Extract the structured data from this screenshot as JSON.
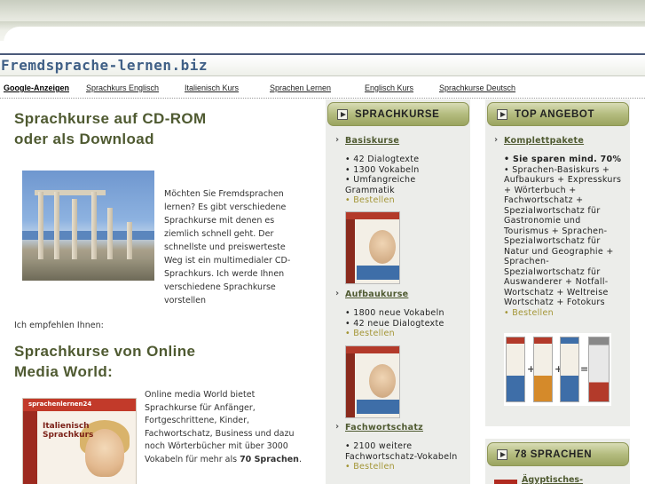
{
  "header": {
    "site_title": "Fremdsprache-lernen.biz"
  },
  "ads": {
    "label": "Google-Anzeigen",
    "links": [
      "Sprachkurs Englisch",
      "Italienisch Kurs",
      "Sprachen Lernen",
      "Englisch Kurs",
      "Sprachkurse Deutsch"
    ]
  },
  "main": {
    "heading1": "Sprachkurse auf CD-ROM oder als Download",
    "intro": "Möchten Sie Fremdsprachen lernen? Es gibt verschiedene Sprachkurse mit denen es ziemlich schnell geht. Der schnellste und preiswerteste Weg ist ein multimedialer CD-Sprachkurs. Ich werde Ihnen verschiedene Sprachkurse vorstellen",
    "recommend": "Ich empfehlen Ihnen:",
    "heading2": "Sprachkurse von Online Media World:",
    "para2_text": "Online media World bietet Sprachkurse für Anfänger, Fortgeschrittene, Kinder, Fachwortschatz, Business und dazu noch Wörterbücher mit über 3000 Vokabeln für mehr als ",
    "para2_bold": "70 Sprachen",
    "para2_end": ".",
    "box_brand": "sprachenlernen24",
    "box_title": "Italienisch Sprachkurs"
  },
  "sprachkurse": {
    "title": "SPRACHKURSE",
    "sections": [
      {
        "link": "Basiskurse",
        "items": [
          "• 42 Dialogtexte",
          "• 1300 Vokabeln",
          "• Umfangreiche Grammatik"
        ],
        "buy": "• Bestellen"
      },
      {
        "link": "Aufbaukurse",
        "items": [
          "• 1800 neue Vokabeln",
          "• 42 neue Dialogtexte"
        ],
        "buy": "• Bestellen"
      },
      {
        "link": "Fachwortschatz",
        "items": [
          "• 2100 weitere Fachwortschatz-Vokabeln"
        ],
        "buy": "• Bestellen"
      }
    ]
  },
  "angebot": {
    "title": "TOP ANGEBOT",
    "link": "Komplettpakete",
    "savings": "• Sie sparen mind. 70%",
    "details": "• Sprachen-Basiskurs + Aufbaukurs + Expresskurs + Wörterbuch + Fachwortschatz + Spezialwortschatz für Gastronomie und Tourismus + Sprachen-Spezialwortschatz für Natur und Geographie + Sprachen-Spezialwortschatz für Auswanderer + Notfall-Wortschatz + Weltreise Wortschatz + Fotokurs",
    "buy": "• Bestellen",
    "ops": [
      "+",
      "+",
      "="
    ]
  },
  "sprachen": {
    "title": "78 SPRACHEN",
    "first_link": "Ägyptisches-"
  },
  "colors": {
    "accent": "#4f5a31",
    "pill": "#b4bc7f",
    "title_blue": "#3f5f86",
    "buy": "#a39535"
  }
}
